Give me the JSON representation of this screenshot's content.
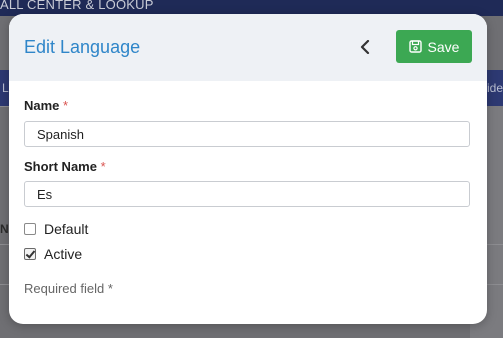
{
  "background": {
    "title": "ALL CENTER & LOOKUP",
    "nav_left": "Lo",
    "nav_right": "ide",
    "side_label": "Na"
  },
  "modal": {
    "title": "Edit Language",
    "save_label": "Save",
    "fields": {
      "name": {
        "label": "Name",
        "required_mark": "*",
        "value": "Spanish"
      },
      "short_name": {
        "label": "Short Name",
        "required_mark": "*",
        "value": "Es"
      }
    },
    "checkboxes": {
      "default": {
        "label": "Default",
        "checked": false
      },
      "active": {
        "label": "Active",
        "checked": true
      }
    },
    "required_note": "Required field *"
  },
  "colors": {
    "title": "#2f86c9",
    "save": "#3ca853",
    "required": "#d9534f"
  }
}
